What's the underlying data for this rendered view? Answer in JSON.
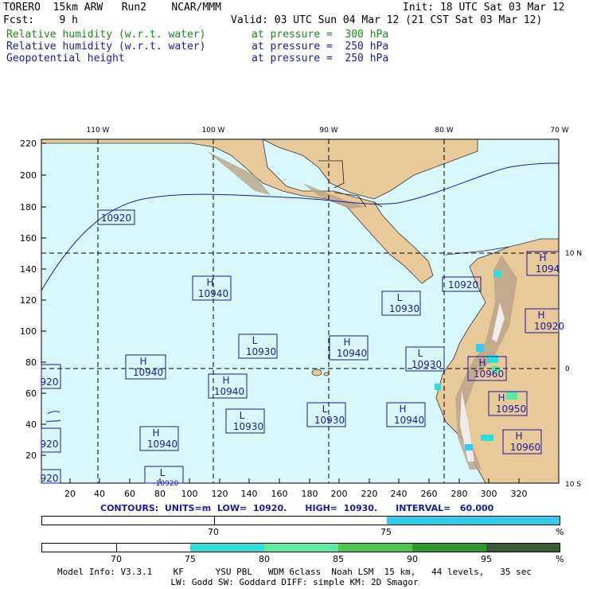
{
  "header": {
    "model": "TORERO  15km ARW   Run2    NCAR/MMM",
    "init": "Init: 18 UTC Sat 03 Mar 12",
    "fcst": "Fcst:    9 h",
    "valid": "Valid: 03 UTC Sun 04 Mar 12 (21 CST Sat 03 Mar 12)",
    "fields": [
      {
        "name": "Relative humidity (w.r.t. water)",
        "level": "at pressure =  300 hPa",
        "color": "#1a8a1a"
      },
      {
        "name": "Relative humidity (w.r.t. water)",
        "level": "at pressure =  250 hPa",
        "color": "#1a1aa0"
      },
      {
        "name": "Geopotential height",
        "level": "at pressure =  250 hPa",
        "color": "#1a1aa0"
      }
    ]
  },
  "map": {
    "ocean_color": "#d8f8fb",
    "land_color": "#e8c99a",
    "top_lon_labels": [
      "110 W",
      "100 W",
      "90 W",
      "80 W",
      "70 W"
    ],
    "right_lat_labels": [
      "10 N",
      "0",
      "10 S"
    ],
    "y_ticks": [
      "220",
      "200",
      "180",
      "160",
      "140",
      "120",
      "100",
      "80",
      "60",
      "40",
      "20"
    ],
    "x_ticks": [
      "20",
      "40",
      "60",
      "80",
      "100",
      "120",
      "140",
      "160",
      "180",
      "200",
      "220",
      "240",
      "260",
      "280",
      "300",
      "320"
    ],
    "centers": [
      {
        "type": "",
        "value": "10920"
      },
      {
        "type": "H",
        "value": "10940"
      },
      {
        "type": "L",
        "value": "10930"
      },
      {
        "type": "L",
        "value": "10930"
      },
      {
        "type": "H",
        "value": "10940"
      },
      {
        "type": "H",
        "value": "10940"
      },
      {
        "type": "H",
        "value": "10940"
      },
      {
        "type": "L",
        "value": "10930"
      },
      {
        "type": "",
        "value": "10920"
      },
      {
        "type": "L",
        "value": "10930"
      },
      {
        "type": "L",
        "value": "10930"
      },
      {
        "type": "H",
        "value": "10940"
      },
      {
        "type": "H",
        "value": "10940"
      },
      {
        "type": "L",
        "value": "10920"
      },
      {
        "type": "H",
        "value": "10960"
      },
      {
        "type": "H",
        "value": "10950"
      },
      {
        "type": "H",
        "value": "10960"
      },
      {
        "type": "H",
        "value": "10920"
      },
      {
        "type": "",
        "value": "920"
      },
      {
        "type": "",
        "value": "920"
      },
      {
        "type": "",
        "value": "920"
      },
      {
        "type": "H",
        "value": "1094"
      }
    ]
  },
  "contours": {
    "text": "CONTOURS:  UNITS=m  LOW=  10920.      HIGH=  10930.      INTERVAL=   60.000"
  },
  "scale1": {
    "labels": [
      "70",
      "75",
      "%"
    ],
    "colors": [
      "#ffffff",
      "#33ccee"
    ]
  },
  "scale2": {
    "labels": [
      "70",
      "75",
      "80",
      "85",
      "90",
      "95",
      "%"
    ],
    "colors": [
      "#ffffff",
      "#ffffff",
      "#2de0d6",
      "#5ee8a0",
      "#4cc64c",
      "#2a9a2a",
      "#3a5a3a"
    ]
  },
  "footer": {
    "line1": "Model Info: V3.3.1    KF      YSU PBL   WDM 6class  Noah LSM  15 km,   44 levels,   35 sec",
    "line2": "LW: Godd SW: Goddard DIFF: simple KM: 2D Smagor"
  }
}
